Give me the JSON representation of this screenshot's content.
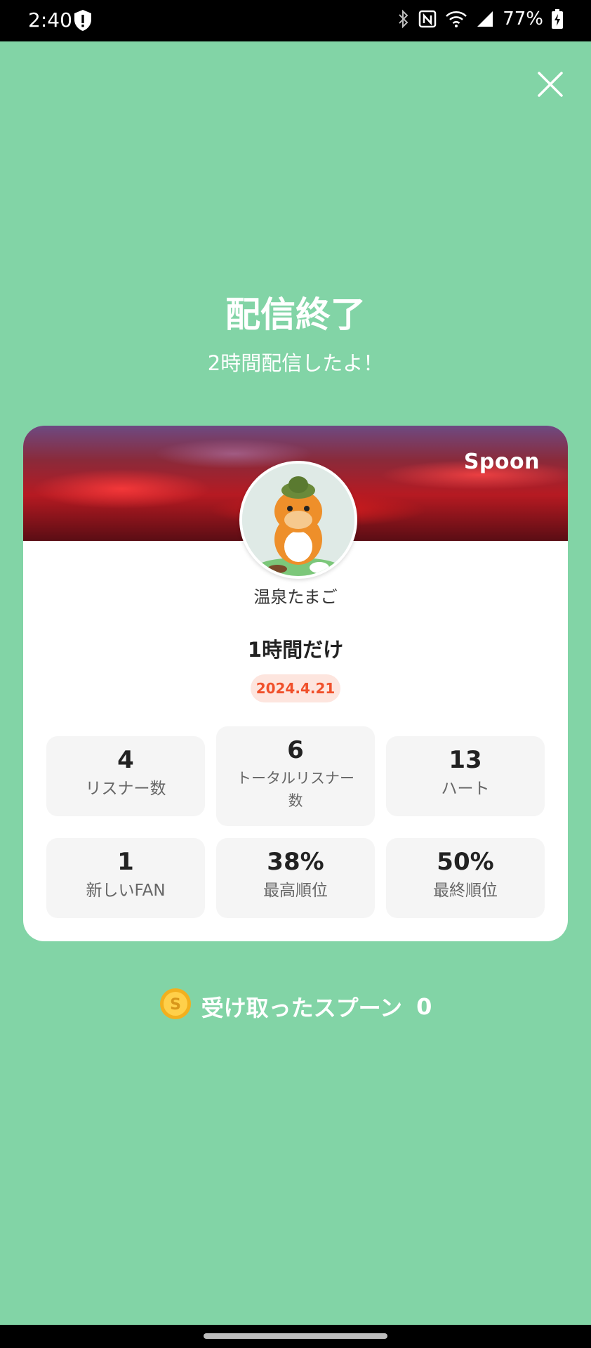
{
  "status_bar": {
    "time": "2:40",
    "battery": "77%",
    "icons": [
      "shield-alert-icon",
      "bluetooth-icon",
      "nfc-icon",
      "wifi-icon",
      "signal-icon",
      "battery-charging-icon"
    ]
  },
  "header": {
    "close_icon": "close-icon",
    "title": "配信終了",
    "subtitle": "2時間配信したよ！"
  },
  "card": {
    "brand": "Spoon",
    "username": "温泉たまご",
    "live_title": "1時間だけ",
    "date": "2024.4.21",
    "stats": [
      {
        "value": "4",
        "label": "リスナー数"
      },
      {
        "value": "6",
        "label": "トータルリスナー数"
      },
      {
        "value": "13",
        "label": "ハート"
      },
      {
        "value": "1",
        "label": "新しいFAN"
      },
      {
        "value": "38%",
        "label": "最高順位"
      },
      {
        "value": "50%",
        "label": "最終順位"
      }
    ]
  },
  "spoons": {
    "coin_icon": "spoon-coin-icon",
    "label": "受け取ったスプーン",
    "count": "0"
  },
  "colors": {
    "background": "#82D4A6",
    "date_text": "#F0502A",
    "date_badge": "#FDE5DE",
    "stat_tile": "#F5F5F5"
  }
}
